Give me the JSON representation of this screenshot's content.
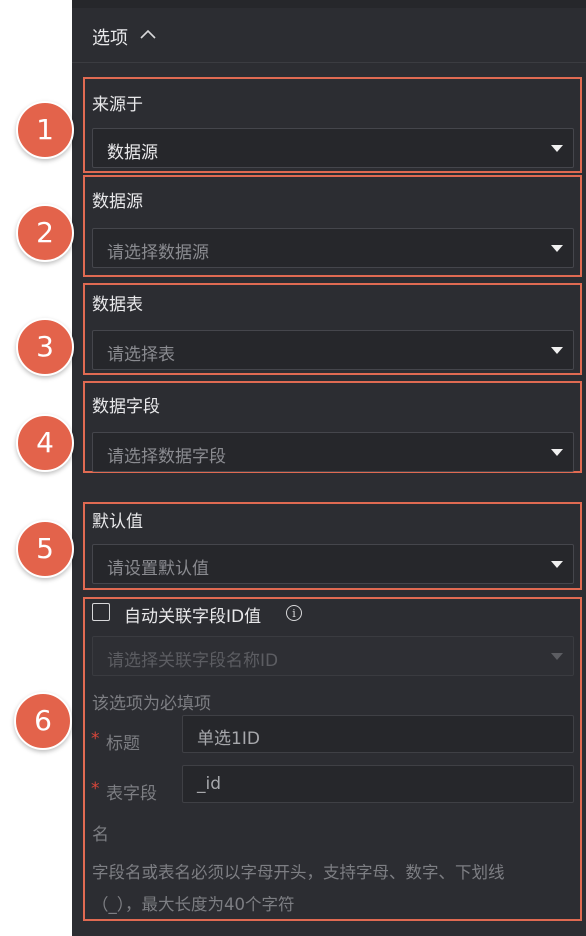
{
  "header": {
    "title": "选项"
  },
  "fields": [
    {
      "label": "来源于",
      "value": "数据源",
      "placeholder": false,
      "badge": "1"
    },
    {
      "label": "数据源",
      "value": "请选择数据源",
      "placeholder": true,
      "badge": "2"
    },
    {
      "label": "数据表",
      "value": "请选择表",
      "placeholder": true,
      "badge": "3"
    },
    {
      "label": "数据字段",
      "value": "请选择数据字段",
      "placeholder": true,
      "badge": "4"
    },
    {
      "label": "默认值",
      "value": "请设置默认值",
      "placeholder": true,
      "badge": "5"
    }
  ],
  "linked": {
    "badge": "6",
    "checkbox_label": "自动关联字段ID值",
    "info_icon": "i",
    "select_placeholder": "请选择关联字段名称ID",
    "required_note": "该选项为必填项",
    "title_label": "标题",
    "title_value": "单选1ID",
    "table_field_label_1": "表字段",
    "table_field_label_2": "名",
    "table_field_value": "_id",
    "required_mark": "*",
    "hint_line_1": "字段名或表名必须以字母开头，支持字母、数字、下划线",
    "hint_line_2": "（_），最大长度为40个字符"
  },
  "colors": {
    "panel_bg": "#2c2d32",
    "highlight": "#e06a52",
    "badge": "#e3634b"
  }
}
